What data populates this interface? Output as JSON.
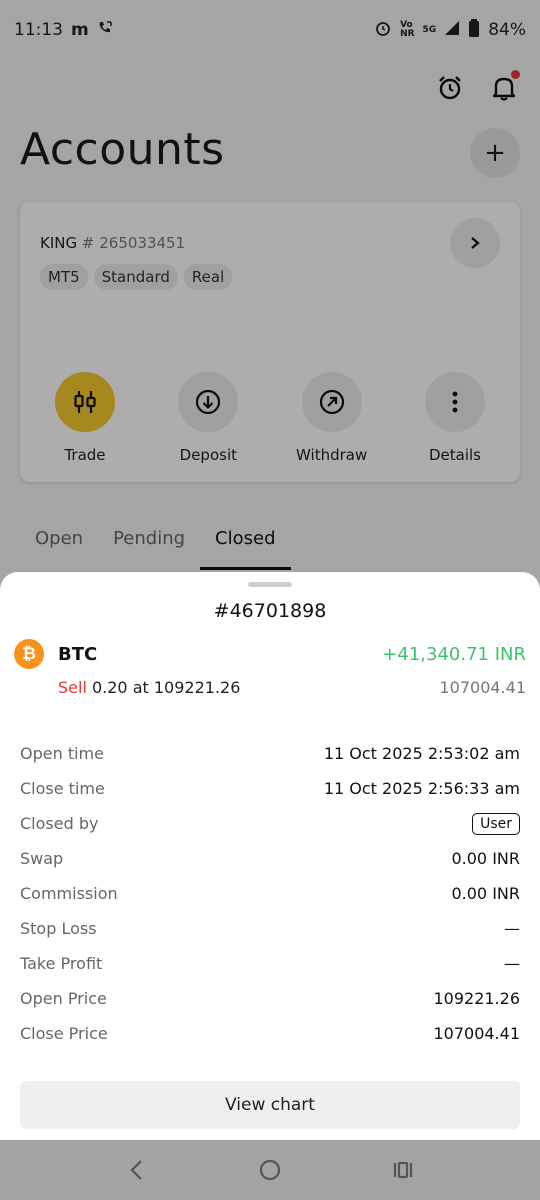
{
  "status_bar": {
    "time": "11:13",
    "carrier_badge": "m",
    "volte_label": "Vo))\nNR",
    "network": "5G",
    "battery": "84%"
  },
  "header": {
    "title": "Accounts"
  },
  "account": {
    "name": "KING",
    "number": "# 265033451",
    "tags": [
      "MT5",
      "Standard",
      "Real"
    ],
    "actions": [
      {
        "label": "Trade",
        "icon": "candlestick-icon"
      },
      {
        "label": "Deposit",
        "icon": "arrow-down-circle-icon"
      },
      {
        "label": "Withdraw",
        "icon": "arrow-up-right-circle-icon"
      },
      {
        "label": "Details",
        "icon": "more-vertical-icon"
      }
    ]
  },
  "tabs": [
    "Open",
    "Pending",
    "Closed"
  ],
  "active_tab": "Closed",
  "position": {
    "ticket": "#46701898",
    "symbol": "BTC",
    "profit": "+41,340.71 INR",
    "side": "Sell",
    "volume_price": "0.20 at 109221.26",
    "current_price": "107004.41",
    "details": [
      {
        "label": "Open time",
        "value": "11 Oct 2025 2:53:02 am"
      },
      {
        "label": "Close time",
        "value": "11 Oct 2025 2:56:33 am"
      },
      {
        "label": "Closed by",
        "value": "User"
      },
      {
        "label": "Swap",
        "value": "0.00 INR"
      },
      {
        "label": "Commission",
        "value": "0.00 INR"
      },
      {
        "label": "Stop Loss",
        "value": "—"
      },
      {
        "label": "Take Profit",
        "value": "—"
      },
      {
        "label": "Open Price",
        "value": "109221.26"
      },
      {
        "label": "Close Price",
        "value": "107004.41"
      }
    ],
    "view_chart_label": "View chart"
  },
  "colors": {
    "accent_yellow": "#f7c92e",
    "profit_green": "#3cc46b",
    "sell_red": "#e53935",
    "btc_orange": "#f7931a"
  }
}
